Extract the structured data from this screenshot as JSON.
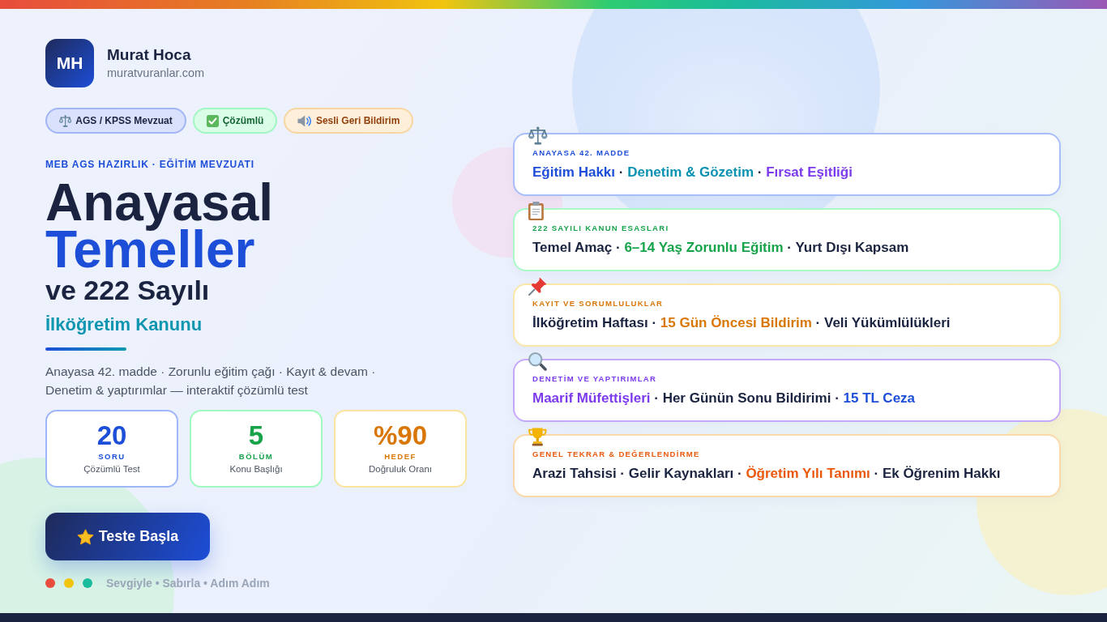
{
  "brand": {
    "monogram": "MH",
    "name": "Murat Hoca",
    "domain": "muratvuranlar.com"
  },
  "tags": [
    {
      "label": "AGS / KPSS Mevzuat",
      "color": "#1a2340"
    },
    {
      "label": "Çözümlü",
      "color": "#166534"
    },
    {
      "label": "Sesli Geri Bildirim",
      "color": "#92400e"
    }
  ],
  "hero": {
    "eyebrow": "MEB AGS HAZIRLIK · EĞİTİM MEVZUATI",
    "title": "Anayasal",
    "title_highlight": "Temeller",
    "subtitle": "ve 222 Sayılı",
    "subtitle_highlight": "İlköğretim Kanunu",
    "description": "Anayasa 42. madde · Zorunlu eğitim çağı · Kayıt & devam · Denetim & yaptırımlar — interaktif çözümlü test"
  },
  "stats": [
    {
      "value": "20",
      "label": "SORU",
      "caption": "Çözümlü Test",
      "color": "#1d4ed8"
    },
    {
      "value": "5",
      "label": "BÖLÜM",
      "caption": "Konu Başlığı",
      "color": "#16a34a"
    },
    {
      "value": "%90",
      "label": "HEDEF",
      "caption": "Doğruluk Oranı",
      "color": "#d97706"
    }
  ],
  "start_button": {
    "label": "Teste Başla"
  },
  "footer": {
    "dots": [
      {
        "color": "#e74c3c"
      },
      {
        "color": "#f1c40f"
      },
      {
        "color": "#1abc9c"
      }
    ],
    "motto": "Sevgiyle • Sabırla • Adım Adım"
  },
  "topics": [
    {
      "eyebrow": "ANAYASA 42. MADDE",
      "color": "#1d4ed8",
      "segments": [
        {
          "kind": "topic",
          "text": "Eğitim Hakkı",
          "color": "#1d4ed8"
        },
        {
          "kind": "separator",
          "text": "·"
        },
        {
          "kind": "topic",
          "text": "Denetim & Gözetim",
          "color": "#0891b2"
        },
        {
          "kind": "separator",
          "text": "·"
        },
        {
          "kind": "topic",
          "text": "Fırsat Eşitliği",
          "color": "#7c3aed"
        }
      ]
    },
    {
      "eyebrow": "222 SAYILI KANUN ESASLARI",
      "color": "#16a34a",
      "segments": [
        {
          "kind": "topic",
          "text": "Temel Amaç",
          "color": "#1a2340"
        },
        {
          "kind": "separator",
          "text": "·"
        },
        {
          "kind": "topic",
          "text": "6–14 Yaş Zorunlu Eğitim",
          "color": "#16a34a"
        },
        {
          "kind": "separator",
          "text": "·"
        },
        {
          "kind": "topic",
          "text": "Yurt Dışı Kapsam",
          "color": "#1a2340"
        }
      ]
    },
    {
      "eyebrow": "KAYIT VE SORUMLULUKLAR",
      "color": "#d97706",
      "segments": [
        {
          "kind": "topic",
          "text": "İlköğretim Haftası",
          "color": "#1a2340"
        },
        {
          "kind": "separator",
          "text": "·"
        },
        {
          "kind": "topic",
          "text": "15 Gün Öncesi Bildirim",
          "color": "#d97706"
        },
        {
          "kind": "separator",
          "text": "·"
        },
        {
          "kind": "topic",
          "text": "Veli Yükümlülükleri",
          "color": "#1a2340"
        }
      ]
    },
    {
      "eyebrow": "DENETİM VE YAPTIRIMLAR",
      "color": "#7c3aed",
      "segments": [
        {
          "kind": "topic",
          "text": "Maarif Müfettişleri",
          "color": "#7c3aed"
        },
        {
          "kind": "separator",
          "text": "·"
        },
        {
          "kind": "topic",
          "text": "Her Günün Sonu Bildirimi",
          "color": "#1a2340"
        },
        {
          "kind": "separator",
          "text": "·"
        },
        {
          "kind": "topic",
          "text": "15 TL Ceza",
          "color": "#1d4ed8"
        }
      ]
    },
    {
      "eyebrow": "GENEL TEKRAR & DEĞERLENDİRME",
      "color": "#ea580c",
      "segments": [
        {
          "kind": "topic",
          "text": "Arazi Tahsisi",
          "color": "#1a2340"
        },
        {
          "kind": "separator",
          "text": "·"
        },
        {
          "kind": "topic",
          "text": "Gelir Kaynakları",
          "color": "#1a2340"
        },
        {
          "kind": "separator",
          "text": "·"
        },
        {
          "kind": "topic",
          "text": "Öğretim Yılı Tanımı",
          "color": "#ea580c"
        },
        {
          "kind": "separator",
          "text": "·"
        },
        {
          "kind": "topic",
          "text": "Ek Öğrenim Hakkı",
          "color": "#1a2340"
        }
      ]
    }
  ]
}
